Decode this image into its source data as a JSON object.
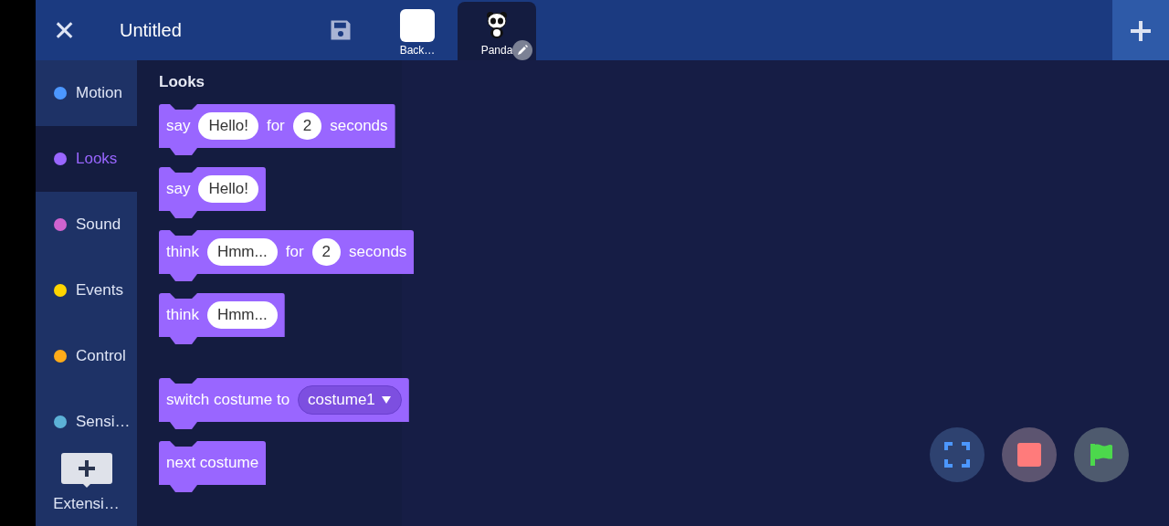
{
  "header": {
    "close": "✕",
    "title": "Untitled"
  },
  "sprites": [
    {
      "kind": "backdrop",
      "label": "Back…",
      "selected": false
    },
    {
      "kind": "sprite",
      "label": "Panda",
      "selected": true
    }
  ],
  "categories": [
    {
      "label": "Motion",
      "color": "#4c97ff",
      "selected": false
    },
    {
      "label": "Looks",
      "color": "#9966ff",
      "selected": true
    },
    {
      "label": "Sound",
      "color": "#cf63cf",
      "selected": false
    },
    {
      "label": "Events",
      "color": "#ffd500",
      "selected": false
    },
    {
      "label": "Control",
      "color": "#ffab19",
      "selected": false
    },
    {
      "label": "Sensi…",
      "color": "#5cb1d6",
      "selected": false
    }
  ],
  "extension": {
    "label": "Extensi…"
  },
  "palette": {
    "heading": "Looks",
    "groups": [
      [
        {
          "parts": [
            {
              "kind": "text",
              "text": "say"
            },
            {
              "kind": "input",
              "text": "Hello!"
            },
            {
              "kind": "text",
              "text": "for"
            },
            {
              "kind": "input",
              "text": "2"
            },
            {
              "kind": "text",
              "text": "seconds"
            }
          ]
        },
        {
          "parts": [
            {
              "kind": "text",
              "text": "say"
            },
            {
              "kind": "input",
              "text": "Hello!"
            }
          ]
        },
        {
          "parts": [
            {
              "kind": "text",
              "text": "think"
            },
            {
              "kind": "input",
              "text": "Hmm..."
            },
            {
              "kind": "text",
              "text": "for"
            },
            {
              "kind": "input",
              "text": "2"
            },
            {
              "kind": "text",
              "text": "seconds"
            }
          ]
        },
        {
          "parts": [
            {
              "kind": "text",
              "text": "think"
            },
            {
              "kind": "input",
              "text": "Hmm..."
            }
          ]
        }
      ],
      [
        {
          "parts": [
            {
              "kind": "text",
              "text": "switch costume to"
            },
            {
              "kind": "dropdown",
              "text": "costume1"
            }
          ]
        },
        {
          "parts": [
            {
              "kind": "text",
              "text": "next costume"
            }
          ]
        }
      ]
    ]
  }
}
